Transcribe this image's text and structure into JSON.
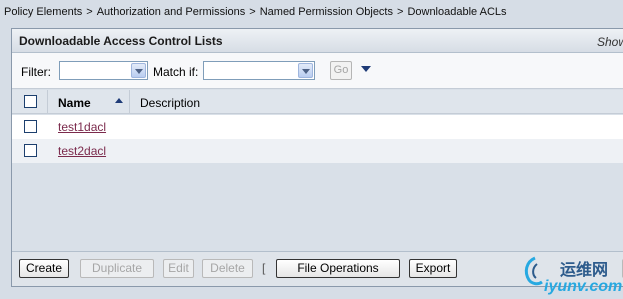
{
  "breadcrumb": {
    "items": [
      "Policy Elements",
      "Authorization and Permissions",
      "Named Permission Objects",
      "Downloadable ACLs"
    ],
    "separator": ">"
  },
  "panel": {
    "title": "Downloadable Access Control Lists",
    "show_label": "Show"
  },
  "filter": {
    "filter_label": "Filter:",
    "filter_value": "",
    "match_label": "Match if:",
    "match_value": "",
    "go_label": "Go",
    "options_icon": "triangle-down-icon"
  },
  "table": {
    "columns": [
      {
        "label": "Name",
        "sort": "ascending"
      },
      {
        "label": "Description"
      }
    ],
    "rows": [
      {
        "name": "test1dacl",
        "description": ""
      },
      {
        "name": "test2dacl",
        "description": ""
      }
    ]
  },
  "footer": {
    "create": "Create",
    "duplicate": "Duplicate",
    "edit": "Edit",
    "delete": "Delete",
    "separator": "[",
    "file_operations": "File Operations",
    "export": "Export"
  },
  "watermark": {
    "cn_text": "运维网",
    "url": "iyunv.com"
  },
  "colors": {
    "background": "#d6dde6",
    "link": "#7b2a4c",
    "watermark_blue": "#27a9e1",
    "accent": "#1f3b77"
  }
}
